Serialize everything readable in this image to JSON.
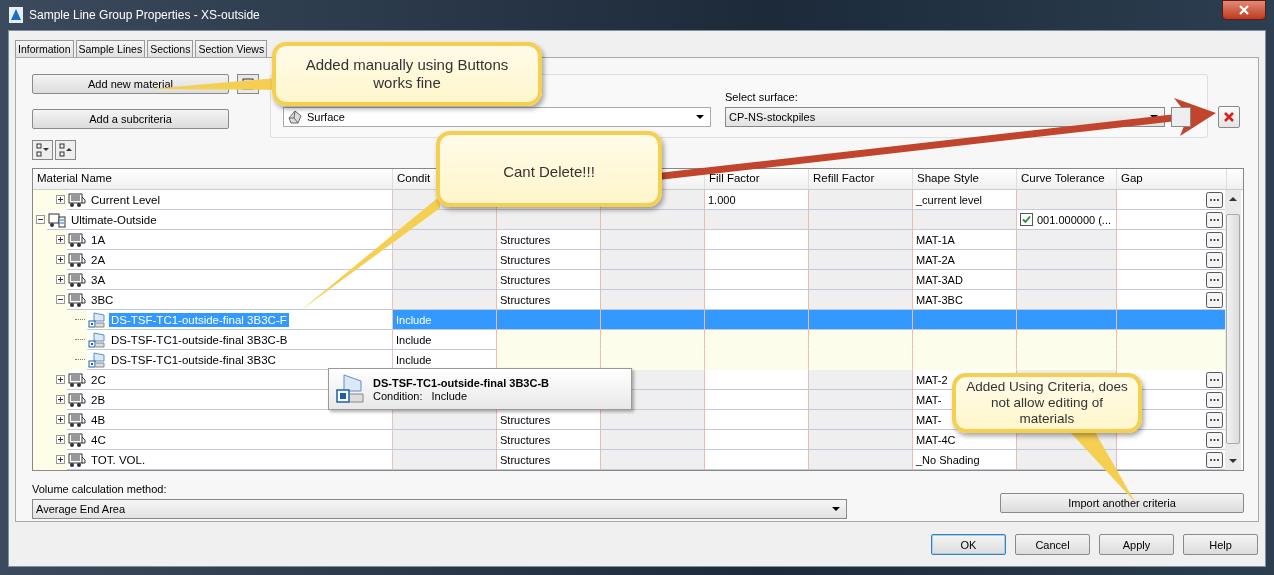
{
  "window": {
    "title": "Sample Line Group Properties - XS-outside"
  },
  "tabs": [
    {
      "label": "Information",
      "selected": false
    },
    {
      "label": "Sample Lines",
      "selected": false
    },
    {
      "label": "Sections",
      "selected": false
    },
    {
      "label": "Section Views",
      "selected": false
    }
  ],
  "buttons": {
    "add_material": "Add new material",
    "add_subcriteria": "Add a subcriteria"
  },
  "surface_panel": {
    "type_value": "Surface",
    "select_label": "Select surface:",
    "surface_value": "CP-NS-stockpiles"
  },
  "table": {
    "columns": {
      "material_name": "Material Name",
      "condition": "Condit",
      "fill_factor": "Fill Factor",
      "refill_factor": "Refill Factor",
      "shape_style": "Shape Style",
      "curve_tolerance": "Curve Tolerance",
      "gap": "Gap"
    },
    "rows": [
      {
        "name": "Current Level",
        "kind": "material",
        "expanded": false,
        "selected": false,
        "fill_factor": "1.000",
        "shape_style": "_current level"
      },
      {
        "name": "Ultimate-Outside",
        "kind": "criteria",
        "expanded": true,
        "selected": false,
        "curve_tolerance": {
          "checked": true,
          "value": "001.000000 (..."
        },
        "children": [
          {
            "name": "1A",
            "kind": "material",
            "expanded": false,
            "selected": false,
            "column_3": "Structures",
            "shape_style": "MAT-1A"
          },
          {
            "name": "2A",
            "kind": "material",
            "expanded": false,
            "selected": false,
            "column_3": "Structures",
            "shape_style": "MAT-2A"
          },
          {
            "name": "3A",
            "kind": "material",
            "expanded": false,
            "selected": false,
            "column_3": "Structures",
            "shape_style": "MAT-3AD"
          },
          {
            "name": "3BC",
            "kind": "material",
            "expanded": true,
            "selected": false,
            "column_3": "Structures",
            "shape_style": "MAT-3BC",
            "children": [
              {
                "name": "DS-TSF-TC1-outside-final 3B3C-F",
                "kind": "condition",
                "selected": true,
                "condition": "Include"
              },
              {
                "name": "DS-TSF-TC1-outside-final 3B3C-B",
                "kind": "condition",
                "selected": false,
                "condition": "Include"
              },
              {
                "name": "DS-TSF-TC1-outside-final 3B3C",
                "kind": "condition",
                "selected": false,
                "condition": "Include"
              }
            ]
          },
          {
            "name": "2C",
            "kind": "material",
            "expanded": false,
            "selected": false,
            "shape_style": "MAT-2"
          },
          {
            "name": "2B",
            "kind": "material",
            "expanded": false,
            "selected": false,
            "shape_style": "MAT-"
          },
          {
            "name": "4B",
            "kind": "material",
            "expanded": false,
            "selected": false,
            "column_3": "Structures",
            "shape_style": "MAT-"
          },
          {
            "name": "4C",
            "kind": "material",
            "expanded": false,
            "selected": false,
            "column_3": "Structures",
            "shape_style": "MAT-4C"
          },
          {
            "name": "TOT. VOL.",
            "kind": "material",
            "expanded": false,
            "selected": false,
            "column_3": "Structures",
            "shape_style": "_No Shading"
          }
        ]
      }
    ]
  },
  "tooltip": {
    "title": "DS-TSF-TC1-outside-final 3B3C-B",
    "label": "Condition:",
    "value": "Include"
  },
  "volume": {
    "label": "Volume calculation method:",
    "value": "Average End Area"
  },
  "import_button": "Import another criteria",
  "dialog_buttons": [
    "OK",
    "Cancel",
    "Apply",
    "Help"
  ],
  "callouts": [
    {
      "text": "Added manually using Buttons works fine"
    },
    {
      "text": "Cant Delete!!!"
    },
    {
      "text": "Added Using Criteria, does not allow editing of materials"
    }
  ]
}
